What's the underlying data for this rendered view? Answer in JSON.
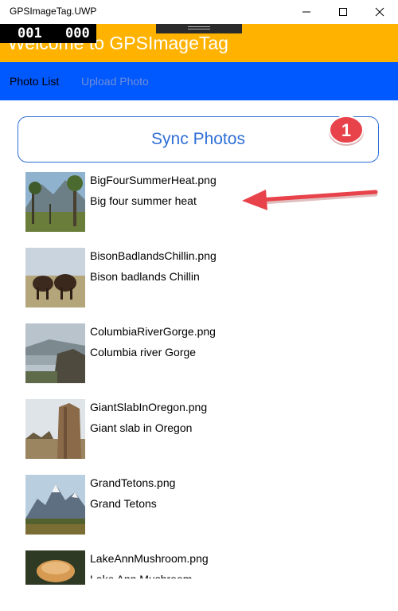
{
  "window": {
    "title": "GPSImageTag.UWP"
  },
  "counter": {
    "left": "001",
    "right": "000"
  },
  "header": {
    "welcome": "Welcome to GPSImageTag",
    "color": "#ffb300"
  },
  "nav": {
    "tabs": [
      {
        "label": "Photo List",
        "active": true
      },
      {
        "label": "Upload Photo",
        "active": false
      }
    ],
    "color": "#0058ff"
  },
  "sync": {
    "label": "Sync Photos",
    "badge": "1",
    "accent": "#2f6fd6"
  },
  "photos": [
    {
      "file": "BigFourSummerHeat.png",
      "caption": "Big four summer heat",
      "thumb": "forest-mountain"
    },
    {
      "file": "BisonBadlandsChillin.png",
      "caption": "Bison badlands Chillin",
      "thumb": "bison"
    },
    {
      "file": "ColumbiaRiverGorge.png",
      "caption": "Columbia river Gorge",
      "thumb": "river-gorge"
    },
    {
      "file": "GiantSlabInOregon.png",
      "caption": "Giant slab in Oregon",
      "thumb": "rock-slab"
    },
    {
      "file": "GrandTetons.png",
      "caption": "Grand Tetons",
      "thumb": "mountains"
    },
    {
      "file": "LakeAnnMushroom.png",
      "caption": "Lake Ann Mushroom",
      "thumb": "mushroom"
    }
  ],
  "annotation": {
    "arrow_color": "#e8424a"
  }
}
